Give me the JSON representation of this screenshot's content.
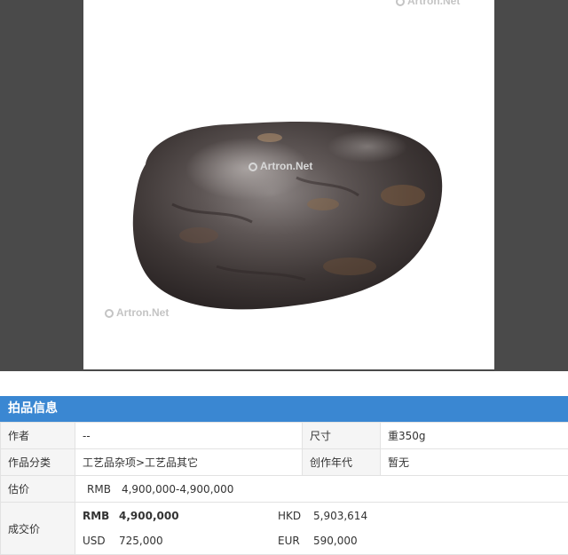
{
  "artwork": {
    "watermark_text": "Artron.Net"
  },
  "section_title": "拍品信息",
  "fields": {
    "author_label": "作者",
    "author_value": "--",
    "size_label": "尺寸",
    "size_value": "重350g",
    "category_label": "作品分类",
    "category_value": "工艺品杂项>工艺品其它",
    "year_label": "创作年代",
    "year_value": "暂无",
    "estimate_label": "估价",
    "estimate_currency": "RMB",
    "estimate_value": "4,900,000-4,900,000",
    "deal_label": "成交价"
  },
  "deal_prices": [
    {
      "currency": "RMB",
      "amount": "4,900,000"
    },
    {
      "currency": "HKD",
      "amount": "5,903,614"
    },
    {
      "currency": "USD",
      "amount": "725,000"
    },
    {
      "currency": "EUR",
      "amount": "590,000"
    }
  ],
  "colors": {
    "header_bg": "#3a87d2",
    "estimate_text": "#b22222",
    "backdrop": "#4a4a4a"
  }
}
